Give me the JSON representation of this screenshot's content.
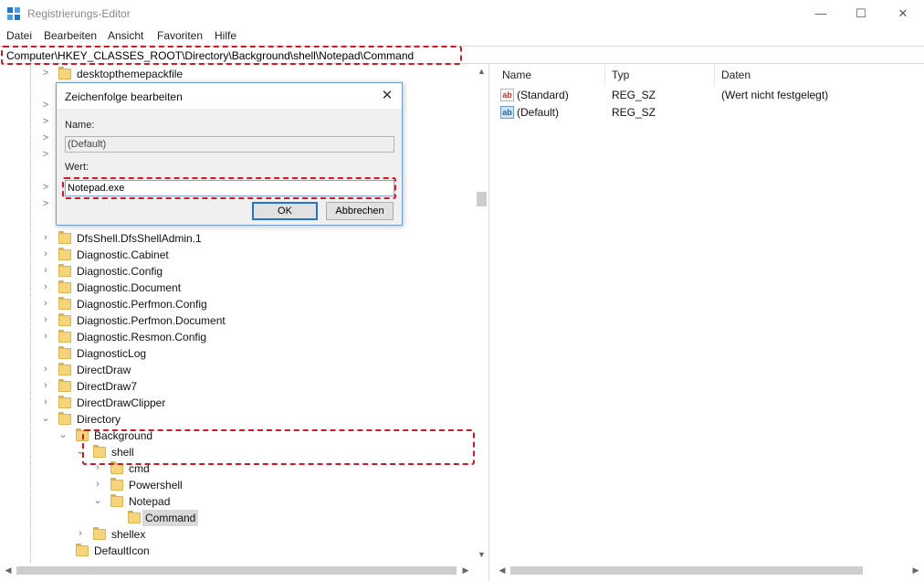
{
  "window": {
    "title": "Registrierungs-Editor",
    "minimize": "—",
    "maximize": "☐",
    "close": "✕"
  },
  "menu": [
    "Datei",
    "Bearbeiten",
    "Ansicht",
    "Favoriten",
    "Hilfe"
  ],
  "address": "Computer\\HKEY_CLASSES_ROOT\\Directory\\Background\\shell\\Notepad\\Command",
  "highlight_color": "#d8161f",
  "tree": {
    "top_item": "desktopthemepackfile",
    "items": [
      {
        "label": "DfsShell.DfsShellAdmin.1",
        "arrow": ">"
      },
      {
        "label": "Diagnostic.Cabinet",
        "arrow": ">"
      },
      {
        "label": "Diagnostic.Config",
        "arrow": ">"
      },
      {
        "label": "Diagnostic.Document",
        "arrow": ">"
      },
      {
        "label": "Diagnostic.Perfmon.Config",
        "arrow": ">"
      },
      {
        "label": "Diagnostic.Perfmon.Document",
        "arrow": ">"
      },
      {
        "label": "Diagnostic.Resmon.Config",
        "arrow": ">"
      },
      {
        "label": "DiagnosticLog",
        "arrow": ""
      },
      {
        "label": "DirectDraw",
        "arrow": ">"
      },
      {
        "label": "DirectDraw7",
        "arrow": ">"
      },
      {
        "label": "DirectDrawClipper",
        "arrow": ">"
      },
      {
        "label": "Directory",
        "arrow": "v"
      },
      {
        "label": "Background",
        "arrow": "v"
      },
      {
        "label": "shell",
        "arrow": "v"
      },
      {
        "label": "cmd",
        "arrow": ">"
      },
      {
        "label": "Powershell",
        "arrow": ">"
      },
      {
        "label": "Notepad",
        "arrow": "v"
      },
      {
        "label": "Command",
        "arrow": ""
      },
      {
        "label": "shellex",
        "arrow": ">"
      },
      {
        "label": "DefaultIcon",
        "arrow": ""
      }
    ]
  },
  "values_pane": {
    "columns": {
      "name": "Name",
      "type": "Typ",
      "data": "Daten"
    },
    "rows": [
      {
        "icon": "string-value-icon",
        "glyph": "ab",
        "name": "(Standard)",
        "type": "REG_SZ",
        "data": "(Wert nicht festgelegt)"
      },
      {
        "icon": "string-value-icon",
        "glyph": "ab",
        "name": "(Default)",
        "type": "REG_SZ",
        "data": ""
      }
    ]
  },
  "dialog": {
    "title": "Zeichenfolge bearbeiten",
    "name_label": "Name:",
    "name_value": "(Default)",
    "value_label": "Wert:",
    "value_value": "Notepad.exe",
    "ok_label": "OK",
    "cancel_label": "Abbrechen"
  }
}
